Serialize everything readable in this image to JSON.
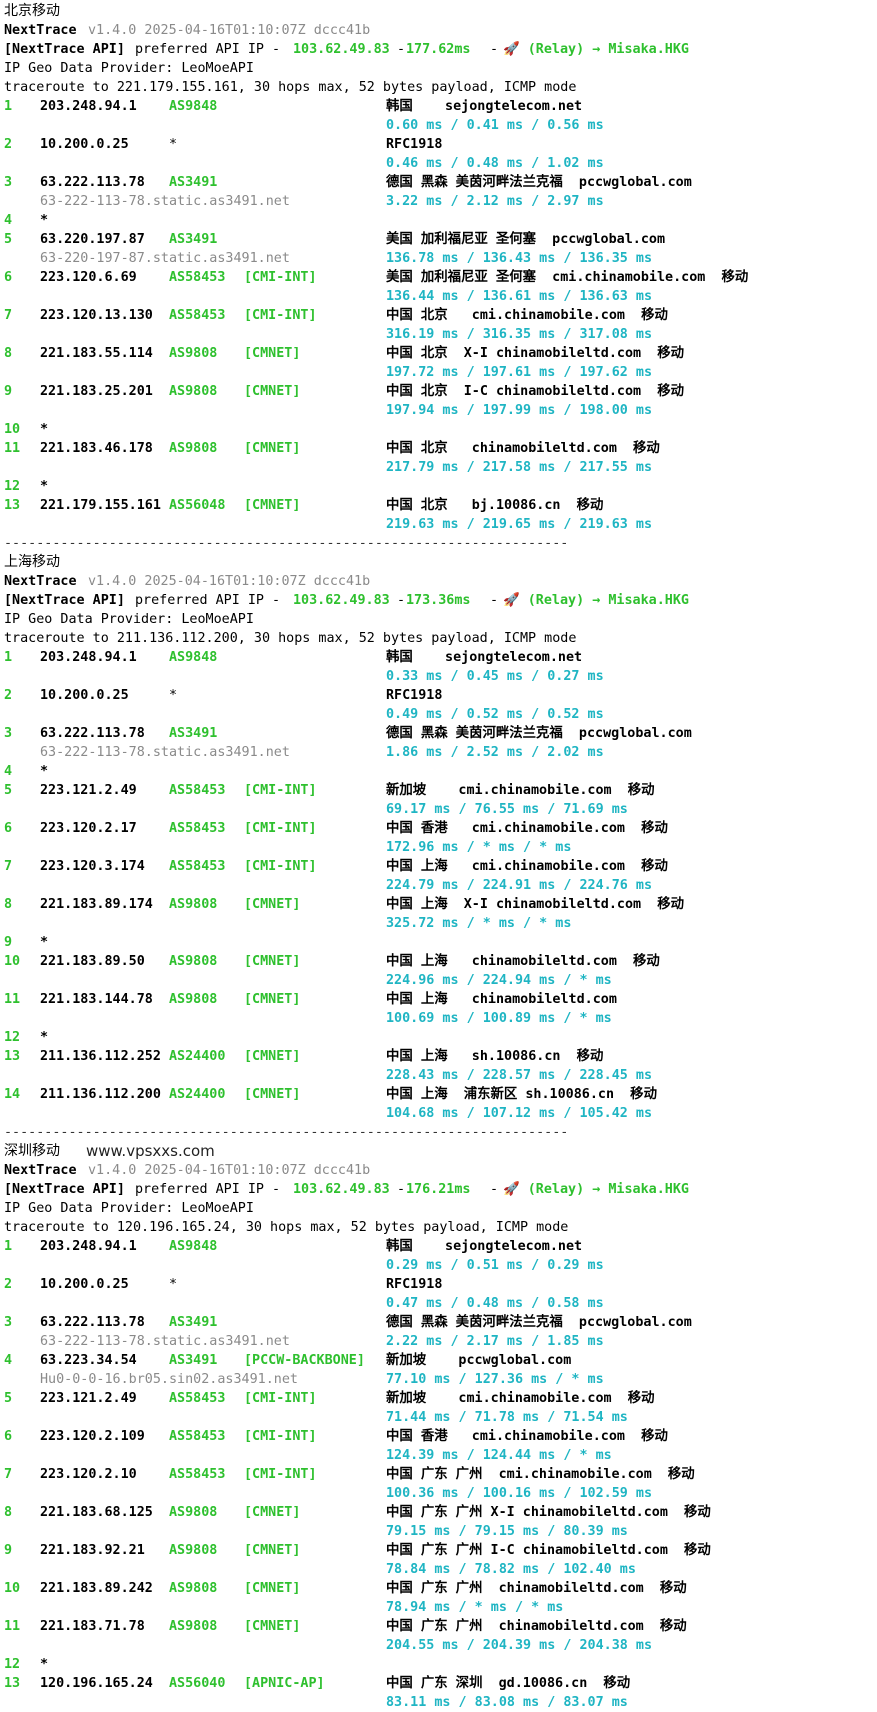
{
  "blocks": [
    {
      "title": "北京移动",
      "watermark": "",
      "version_label": "NextTrace",
      "version_meta": "v1.4.0 2025-04-16T01:10:07Z dccc41b",
      "api_label": "[NextTrace API]",
      "api_text": "preferred API IP - ",
      "api_ip": "103.62.49.83",
      "api_dash": " - ",
      "api_latency": "177.62ms",
      "api_dash2": " - ",
      "api_relay": "🚀 (Relay) → Misaka.HKG",
      "geo_provider": "IP Geo Data Provider: LeoMoeAPI",
      "trace_line": "traceroute to 221.179.155.161, 30 hops max, 52 bytes payload, ICMP mode",
      "hops": [
        {
          "n": "1",
          "ip": "203.248.94.1",
          "asn": "AS9848",
          "tag": "",
          "loc": "韩国    sejongtelecom.net",
          "times": "0.60 ms / 0.41 ms / 0.56 ms",
          "rdns": ""
        },
        {
          "n": "2",
          "ip": "10.200.0.25",
          "asn": "*",
          "tag": "",
          "loc": "RFC1918",
          "times": "0.46 ms / 0.48 ms / 1.02 ms",
          "rdns": ""
        },
        {
          "n": "3",
          "ip": "63.222.113.78",
          "asn": "AS3491",
          "tag": "",
          "loc": "德国 黑森 美茵河畔法兰克福  pccwglobal.com",
          "times": "3.22 ms / 2.12 ms / 2.97 ms",
          "rdns": "63-222-113-78.static.as3491.net"
        },
        {
          "n": "4",
          "ip": "*",
          "asn": "",
          "tag": "",
          "loc": "",
          "times": "",
          "rdns": ""
        },
        {
          "n": "5",
          "ip": "63.220.197.87",
          "asn": "AS3491",
          "tag": "",
          "loc": "美国 加利福尼亚 圣何塞  pccwglobal.com",
          "times": "136.78 ms / 136.43 ms / 136.35 ms",
          "rdns": "63-220-197-87.static.as3491.net"
        },
        {
          "n": "6",
          "ip": "223.120.6.69",
          "asn": "AS58453",
          "tag": "[CMI-INT]",
          "loc": "美国 加利福尼亚 圣何塞  cmi.chinamobile.com  移动",
          "times": "136.44 ms / 136.61 ms / 136.63 ms",
          "rdns": ""
        },
        {
          "n": "7",
          "ip": "223.120.13.130",
          "asn": "AS58453",
          "tag": "[CMI-INT]",
          "loc": "中国 北京   cmi.chinamobile.com  移动",
          "times": "316.19 ms / 316.35 ms / 317.08 ms",
          "rdns": ""
        },
        {
          "n": "8",
          "ip": "221.183.55.114",
          "asn": "AS9808",
          "tag": "[CMNET]",
          "loc": "中国 北京  X-I chinamobileltd.com  移动",
          "times": "197.72 ms / 197.61 ms / 197.62 ms",
          "rdns": ""
        },
        {
          "n": "9",
          "ip": "221.183.25.201",
          "asn": "AS9808",
          "tag": "[CMNET]",
          "loc": "中国 北京  I-C chinamobileltd.com  移动",
          "times": "197.94 ms / 197.99 ms / 198.00 ms",
          "rdns": ""
        },
        {
          "n": "10",
          "ip": "*",
          "asn": "",
          "tag": "",
          "loc": "",
          "times": "",
          "rdns": ""
        },
        {
          "n": "11",
          "ip": "221.183.46.178",
          "asn": "AS9808",
          "tag": "[CMNET]",
          "loc": "中国 北京   chinamobileltd.com  移动",
          "times": "217.79 ms / 217.58 ms / 217.55 ms",
          "rdns": ""
        },
        {
          "n": "12",
          "ip": "*",
          "asn": "",
          "tag": "",
          "loc": "",
          "times": "",
          "rdns": ""
        },
        {
          "n": "13",
          "ip": "221.179.155.161",
          "asn": "AS56048",
          "tag": "[CMNET]",
          "loc": "中国 北京   bj.10086.cn  移动",
          "times": "219.63 ms / 219.65 ms / 219.63 ms",
          "rdns": ""
        }
      ]
    },
    {
      "title": "上海移动",
      "watermark": "",
      "version_label": "NextTrace",
      "version_meta": "v1.4.0 2025-04-16T01:10:07Z dccc41b",
      "api_label": "[NextTrace API]",
      "api_text": "preferred API IP - ",
      "api_ip": "103.62.49.83",
      "api_dash": " - ",
      "api_latency": "173.36ms",
      "api_dash2": " - ",
      "api_relay": "🚀 (Relay) → Misaka.HKG",
      "geo_provider": "IP Geo Data Provider: LeoMoeAPI",
      "trace_line": "traceroute to 211.136.112.200, 30 hops max, 52 bytes payload, ICMP mode",
      "hops": [
        {
          "n": "1",
          "ip": "203.248.94.1",
          "asn": "AS9848",
          "tag": "",
          "loc": "韩国    sejongtelecom.net",
          "times": "0.33 ms / 0.45 ms / 0.27 ms",
          "rdns": ""
        },
        {
          "n": "2",
          "ip": "10.200.0.25",
          "asn": "*",
          "tag": "",
          "loc": "RFC1918",
          "times": "0.49 ms / 0.52 ms / 0.52 ms",
          "rdns": ""
        },
        {
          "n": "3",
          "ip": "63.222.113.78",
          "asn": "AS3491",
          "tag": "",
          "loc": "德国 黑森 美茵河畔法兰克福  pccwglobal.com",
          "times": "1.86 ms / 2.52 ms / 2.02 ms",
          "rdns": "63-222-113-78.static.as3491.net"
        },
        {
          "n": "4",
          "ip": "*",
          "asn": "",
          "tag": "",
          "loc": "",
          "times": "",
          "rdns": ""
        },
        {
          "n": "5",
          "ip": "223.121.2.49",
          "asn": "AS58453",
          "tag": "[CMI-INT]",
          "loc": "新加坡    cmi.chinamobile.com  移动",
          "times": "69.17 ms / 76.55 ms / 71.69 ms",
          "rdns": ""
        },
        {
          "n": "6",
          "ip": "223.120.2.17",
          "asn": "AS58453",
          "tag": "[CMI-INT]",
          "loc": "中国 香港   cmi.chinamobile.com  移动",
          "times": "172.96 ms / * ms / * ms",
          "rdns": ""
        },
        {
          "n": "7",
          "ip": "223.120.3.174",
          "asn": "AS58453",
          "tag": "[CMI-INT]",
          "loc": "中国 上海   cmi.chinamobile.com  移动",
          "times": "224.79 ms / 224.91 ms / 224.76 ms",
          "rdns": ""
        },
        {
          "n": "8",
          "ip": "221.183.89.174",
          "asn": "AS9808",
          "tag": "[CMNET]",
          "loc": "中国 上海  X-I chinamobileltd.com  移动",
          "times": "325.72 ms / * ms / * ms",
          "rdns": ""
        },
        {
          "n": "9",
          "ip": "*",
          "asn": "",
          "tag": "",
          "loc": "",
          "times": "",
          "rdns": ""
        },
        {
          "n": "10",
          "ip": "221.183.89.50",
          "asn": "AS9808",
          "tag": "[CMNET]",
          "loc": "中国 上海   chinamobileltd.com  移动",
          "times": "224.96 ms / 224.94 ms / * ms",
          "rdns": ""
        },
        {
          "n": "11",
          "ip": "221.183.144.78",
          "asn": "AS9808",
          "tag": "[CMNET]",
          "loc": "中国 上海   chinamobileltd.com",
          "times": "100.69 ms / 100.89 ms / * ms",
          "rdns": ""
        },
        {
          "n": "12",
          "ip": "*",
          "asn": "",
          "tag": "",
          "loc": "",
          "times": "",
          "rdns": ""
        },
        {
          "n": "13",
          "ip": "211.136.112.252",
          "asn": "AS24400",
          "tag": "[CMNET]",
          "loc": "中国 上海   sh.10086.cn  移动",
          "times": "228.43 ms / 228.57 ms / 228.45 ms",
          "rdns": ""
        },
        {
          "n": "14",
          "ip": "211.136.112.200",
          "asn": "AS24400",
          "tag": "[CMNET]",
          "loc": "中国 上海  浦东新区 sh.10086.cn  移动",
          "times": "104.68 ms / 107.12 ms / 105.42 ms",
          "rdns": ""
        }
      ]
    },
    {
      "title": "深圳移动",
      "watermark": "www.vpsxxs.com",
      "version_label": "NextTrace",
      "version_meta": "v1.4.0 2025-04-16T01:10:07Z dccc41b",
      "api_label": "[NextTrace API]",
      "api_text": "preferred API IP - ",
      "api_ip": "103.62.49.83",
      "api_dash": " - ",
      "api_latency": "176.21ms",
      "api_dash2": " - ",
      "api_relay": "🚀 (Relay) → Misaka.HKG",
      "geo_provider": "IP Geo Data Provider: LeoMoeAPI",
      "trace_line": "traceroute to 120.196.165.24, 30 hops max, 52 bytes payload, ICMP mode",
      "hops": [
        {
          "n": "1",
          "ip": "203.248.94.1",
          "asn": "AS9848",
          "tag": "",
          "loc": "韩国    sejongtelecom.net",
          "times": "0.29 ms / 0.51 ms / 0.29 ms",
          "rdns": ""
        },
        {
          "n": "2",
          "ip": "10.200.0.25",
          "asn": "*",
          "tag": "",
          "loc": "RFC1918",
          "times": "0.47 ms / 0.48 ms / 0.58 ms",
          "rdns": ""
        },
        {
          "n": "3",
          "ip": "63.222.113.78",
          "asn": "AS3491",
          "tag": "",
          "loc": "德国 黑森 美茵河畔法兰克福  pccwglobal.com",
          "times": "2.22 ms / 2.17 ms / 1.85 ms",
          "rdns": "63-222-113-78.static.as3491.net"
        },
        {
          "n": "4",
          "ip": "63.223.34.54",
          "asn": "AS3491",
          "tag": "[PCCW-BACKBONE]",
          "loc": "新加坡    pccwglobal.com",
          "times": "77.10 ms / 127.36 ms / * ms",
          "rdns": "Hu0-0-0-16.br05.sin02.as3491.net"
        },
        {
          "n": "5",
          "ip": "223.121.2.49",
          "asn": "AS58453",
          "tag": "[CMI-INT]",
          "loc": "新加坡    cmi.chinamobile.com  移动",
          "times": "71.44 ms / 71.78 ms / 71.54 ms",
          "rdns": ""
        },
        {
          "n": "6",
          "ip": "223.120.2.109",
          "asn": "AS58453",
          "tag": "[CMI-INT]",
          "loc": "中国 香港   cmi.chinamobile.com  移动",
          "times": "124.39 ms / 124.44 ms / * ms",
          "rdns": ""
        },
        {
          "n": "7",
          "ip": "223.120.2.10",
          "asn": "AS58453",
          "tag": "[CMI-INT]",
          "loc": "中国 广东 广州  cmi.chinamobile.com  移动",
          "times": "100.36 ms / 100.16 ms / 102.59 ms",
          "rdns": ""
        },
        {
          "n": "8",
          "ip": "221.183.68.125",
          "asn": "AS9808",
          "tag": "[CMNET]",
          "loc": "中国 广东 广州 X-I chinamobileltd.com  移动",
          "times": "79.15 ms / 79.15 ms / 80.39 ms",
          "rdns": ""
        },
        {
          "n": "9",
          "ip": "221.183.92.21",
          "asn": "AS9808",
          "tag": "[CMNET]",
          "loc": "中国 广东 广州 I-C chinamobileltd.com  移动",
          "times": "78.84 ms / 78.82 ms / 102.40 ms",
          "rdns": ""
        },
        {
          "n": "10",
          "ip": "221.183.89.242",
          "asn": "AS9808",
          "tag": "[CMNET]",
          "loc": "中国 广东 广州  chinamobileltd.com  移动",
          "times": "78.94 ms / * ms / * ms",
          "rdns": ""
        },
        {
          "n": "11",
          "ip": "221.183.71.78",
          "asn": "AS9808",
          "tag": "[CMNET]",
          "loc": "中国 广东 广州  chinamobileltd.com  移动",
          "times": "204.55 ms / 204.39 ms / 204.38 ms",
          "rdns": ""
        },
        {
          "n": "12",
          "ip": "*",
          "asn": "",
          "tag": "",
          "loc": "",
          "times": "",
          "rdns": ""
        },
        {
          "n": "13",
          "ip": "120.196.165.24",
          "asn": "AS56040",
          "tag": "[APNIC-AP]",
          "loc": "中国 广东 深圳  gd.10086.cn  移动",
          "times": "83.11 ms / 83.08 ms / 83.07 ms",
          "rdns": ""
        }
      ]
    }
  ],
  "separator": "----------------------------------------------------------------------"
}
